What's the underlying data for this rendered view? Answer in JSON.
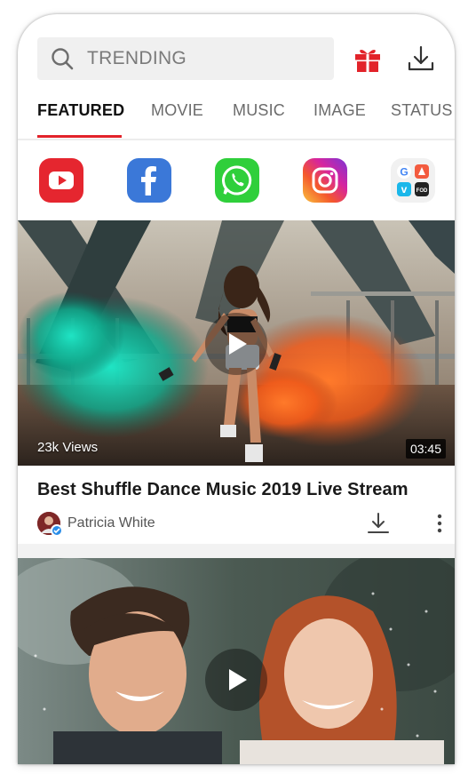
{
  "search": {
    "placeholder": "TRENDING",
    "icon": "search-icon"
  },
  "header": {
    "gift_icon": "gift-icon",
    "download_icon": "download-icon"
  },
  "tabs": [
    {
      "label": "FEATURED",
      "active": true
    },
    {
      "label": "MOVIE",
      "active": false
    },
    {
      "label": "MUSIC",
      "active": false
    },
    {
      "label": "IMAGE",
      "active": false
    },
    {
      "label": "STATUS",
      "active": false
    }
  ],
  "apps": [
    {
      "name": "youtube-icon",
      "color": "#e5262f"
    },
    {
      "name": "facebook-icon",
      "color": "#3b78d8"
    },
    {
      "name": "whatsapp-icon",
      "color": "#2fcf3b"
    },
    {
      "name": "instagram-icon",
      "color": "#d6249f"
    },
    {
      "name": "more-apps-icon",
      "color": "#f1f1f1"
    }
  ],
  "videos": [
    {
      "views": "23k Views",
      "duration": "03:45",
      "title": "Best Shuffle Dance Music 2019 Live Stream",
      "author": "Patricia White"
    },
    {
      "views": "",
      "duration": "",
      "title": "",
      "author": ""
    }
  ],
  "colors": {
    "accent": "#e2232a",
    "text": "#1a1a1a",
    "muted": "#6b6b6b"
  }
}
